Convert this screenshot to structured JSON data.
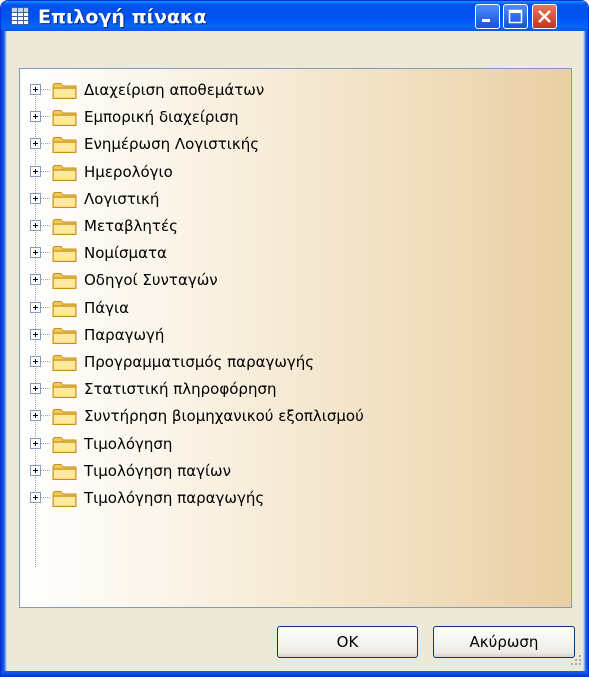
{
  "window": {
    "title": "Επιλογή πίνακα"
  },
  "tree": {
    "items": [
      {
        "label": "Διαχείριση αποθεμάτων"
      },
      {
        "label": "Εμπορική διαχείριση"
      },
      {
        "label": "Ενημέρωση Λογιστικής"
      },
      {
        "label": "Ημερολόγιο"
      },
      {
        "label": "Λογιστική"
      },
      {
        "label": "Μεταβλητές"
      },
      {
        "label": "Νομίσματα"
      },
      {
        "label": "Οδηγοί Συνταγών"
      },
      {
        "label": "Πάγια"
      },
      {
        "label": "Παραγωγή"
      },
      {
        "label": "Προγραμματισμός παραγωγής"
      },
      {
        "label": "Στατιστική πληροφόρηση"
      },
      {
        "label": "Συντήρηση βιομηχανικού εξοπλισμού"
      },
      {
        "label": "Τιμολόγηση"
      },
      {
        "label": "Τιμολόγηση παγίων"
      },
      {
        "label": "Τιμολόγηση παραγωγής"
      }
    ]
  },
  "buttons": {
    "ok": "OK",
    "cancel": "Ακύρωση"
  },
  "colors": {
    "titlebar": "#0054e3",
    "close": "#c1351a",
    "window_bg": "#ece9d8"
  },
  "icons": [
    "table-icon",
    "minimize-icon",
    "maximize-icon",
    "close-icon",
    "folder-icon",
    "plus-expander-icon",
    "resize-grip-icon"
  ]
}
